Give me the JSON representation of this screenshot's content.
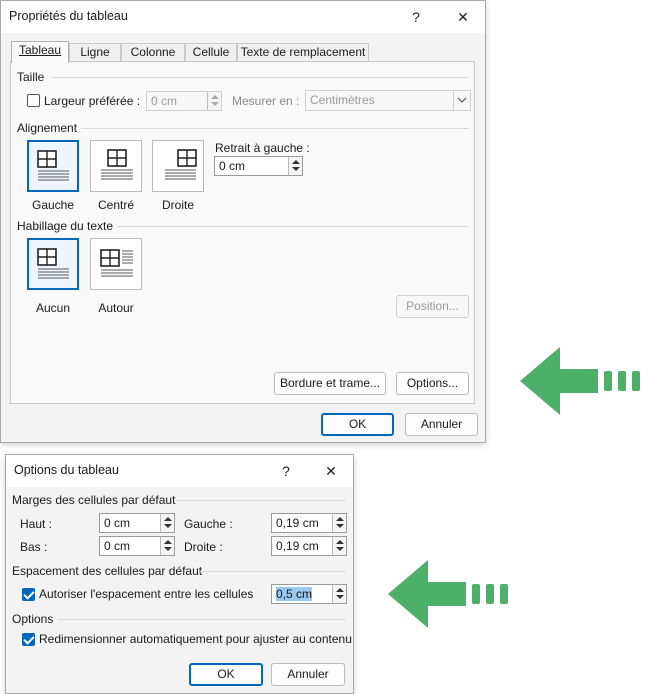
{
  "table_props": {
    "title": "Propriétés du tableau",
    "help": "?",
    "close": "✕",
    "tabs": [
      {
        "label": "Tableau"
      },
      {
        "label": "Ligne"
      },
      {
        "label": "Colonne"
      },
      {
        "label": "Cellule"
      },
      {
        "label": "Texte de remplacement"
      }
    ],
    "size": {
      "group": "Taille",
      "preferred_width_label": "Largeur préférée :",
      "preferred_width_checked": false,
      "preferred_width_value": "0 cm",
      "measure_label": "Mesurer en :",
      "measure_value": "Centimètres"
    },
    "alignment": {
      "group": "Alignement",
      "options": [
        "Gauche",
        "Centré",
        "Droite"
      ],
      "selected": "Gauche",
      "indent_label": "Retrait à gauche :",
      "indent_value": "0 cm"
    },
    "wrapping": {
      "group": "Habillage du texte",
      "options": [
        "Aucun",
        "Autour"
      ],
      "selected": "Aucun"
    },
    "position_button": "Position...",
    "borders_button": "Bordure et trame...",
    "options_button": "Options...",
    "ok": "OK",
    "cancel": "Annuler"
  },
  "table_options": {
    "title": "Options du tableau",
    "help": "?",
    "close": "✕",
    "margins": {
      "group": "Marges des cellules par défaut",
      "top_label": "Haut :",
      "top_value": "0 cm",
      "bottom_label": "Bas :",
      "bottom_value": "0 cm",
      "left_label": "Gauche :",
      "left_value": "0,19 cm",
      "right_label": "Droite :",
      "right_value": "0,19 cm"
    },
    "spacing": {
      "group": "Espacement des cellules par défaut",
      "allow_label": "Autoriser l'espacement entre les cellules",
      "allow_checked": true,
      "value": "0,5 cm"
    },
    "options": {
      "group": "Options",
      "autoresize_label": "Redimensionner automatiquement pour ajuster au contenu",
      "autoresize_checked": true
    },
    "ok": "OK",
    "cancel": "Annuler"
  },
  "colors": {
    "accent": "#0067c0",
    "arrow": "#4caf6a",
    "selection": "#99c9ef"
  }
}
